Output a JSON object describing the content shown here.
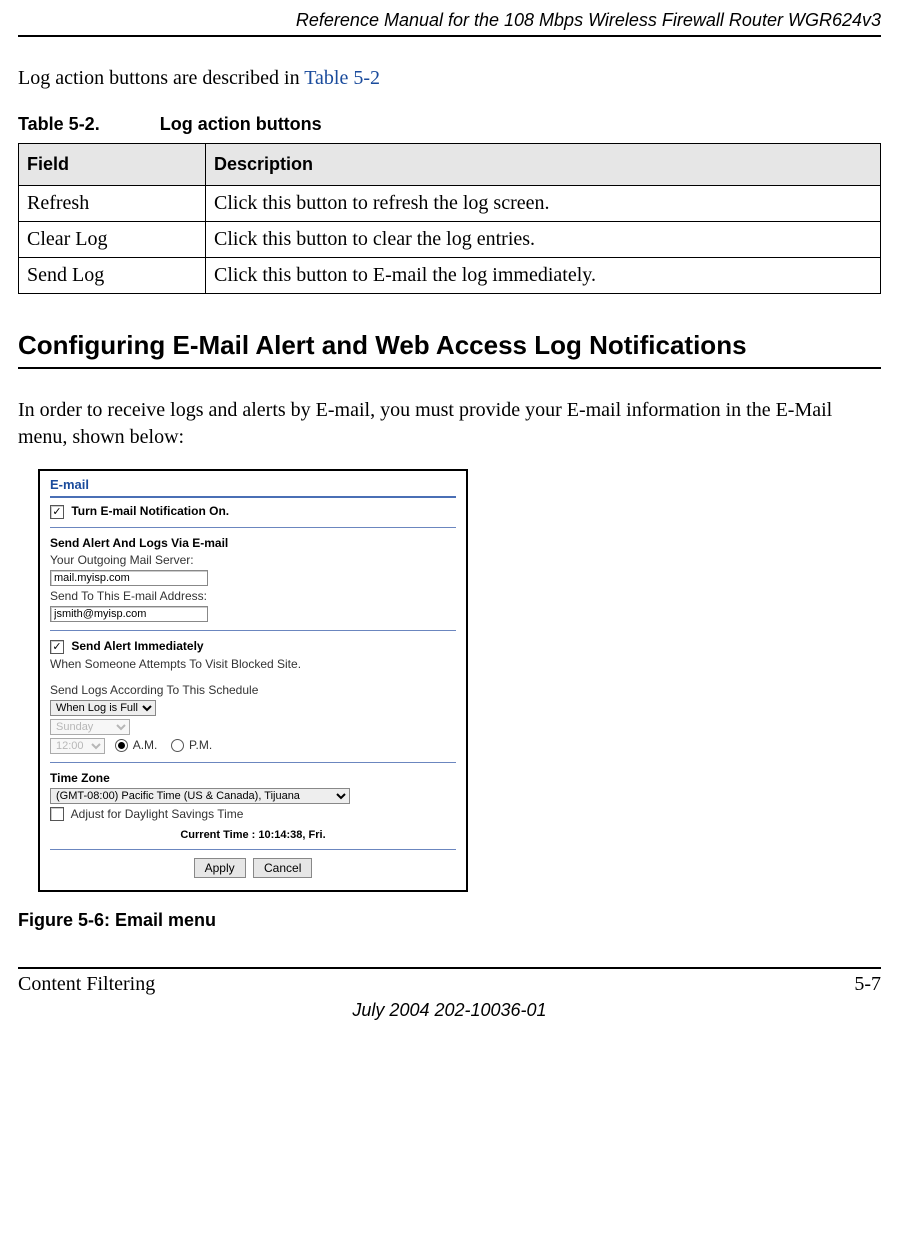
{
  "header": {
    "running": "Reference Manual for the 108 Mbps Wireless Firewall Router WGR624v3"
  },
  "intro": {
    "text_prefix": "Log action buttons are described in ",
    "xref": "Table 5-2"
  },
  "table52": {
    "caption_num": "Table 5-2.",
    "caption_title": "Log action buttons",
    "head_field": "Field",
    "head_desc": "Description",
    "rows": [
      {
        "field": "Refresh",
        "desc": "Click this button to refresh the log screen."
      },
      {
        "field": "Clear Log",
        "desc": "Click this button to clear the log entries."
      },
      {
        "field": "Send Log",
        "desc": "Click this button to E-mail the log immediately."
      }
    ]
  },
  "section": {
    "title": "Configuring E-Mail Alert and Web Access Log Notifications",
    "para": "In order to receive logs and alerts by E-mail, you must provide your E-mail information in the E-Mail menu, shown below:"
  },
  "email_panel": {
    "title": "E-mail",
    "notify_label": "Turn E-mail Notification On.",
    "send_section": "Send Alert And Logs Via E-mail",
    "outgoing_label": "Your Outgoing Mail Server:",
    "outgoing_value": "mail.myisp.com",
    "sendto_label": "Send To This E-mail Address:",
    "sendto_value": "jsmith@myisp.com",
    "alert_immediately": "Send Alert Immediately",
    "alert_sub": "When Someone Attempts To Visit Blocked Site.",
    "schedule_label": "Send Logs According To This Schedule",
    "schedule_value": "When Log is Full",
    "day_value": "Sunday",
    "time_value": "12:00",
    "am": "A.M.",
    "pm": "P.M.",
    "tz_section": "Time Zone",
    "tz_value": "(GMT-08:00) Pacific Time (US & Canada), Tijuana",
    "dst_label": "Adjust for Daylight Savings Time",
    "current_time": "Current Time : 10:14:38, Fri.",
    "apply": "Apply",
    "cancel": "Cancel"
  },
  "figure": {
    "caption": "Figure 5-6:  Email menu"
  },
  "footer": {
    "left": "Content Filtering",
    "right": "5-7",
    "date": "July 2004 202-10036-01"
  }
}
